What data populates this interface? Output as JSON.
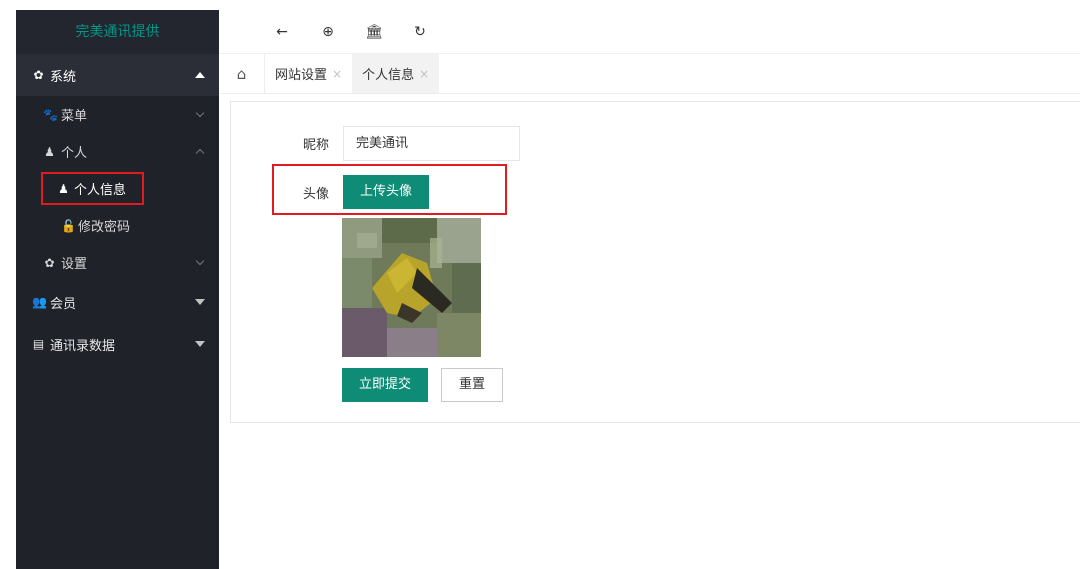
{
  "sidebar": {
    "logo": "完美通讯提供",
    "top_item": {
      "label": "系统",
      "icon": "gear-icon"
    },
    "menu": {
      "label": "菜单",
      "icon": "paw-icon"
    },
    "personal": {
      "label": "个人",
      "icon": "user-icon"
    },
    "personal_info": {
      "label": "个人信息",
      "icon": "user-icon"
    },
    "change_password": {
      "label": "修改密码",
      "icon": "lock-icon"
    },
    "settings": {
      "label": "设置",
      "icon": "gear-icon"
    },
    "members": {
      "label": "会员",
      "icon": "users-icon"
    },
    "contacts": {
      "label": "通讯录数据",
      "icon": "id-card-icon"
    }
  },
  "toolbar": {
    "back_icon": "arrow-left-icon",
    "web_icon": "globe-icon",
    "bank_icon": "bank-icon",
    "refresh_icon": "refresh-icon"
  },
  "tabs": [
    {
      "label": "网站设置",
      "close": "×"
    },
    {
      "label": "个人信息",
      "close": "×"
    }
  ],
  "form": {
    "nickname_label": "昵称",
    "nickname_value": "完美通讯",
    "avatar_label": "头像",
    "upload_button": "上传头像",
    "submit_button": "立即提交",
    "reset_button": "重置"
  },
  "colors": {
    "sidebar_bg": "#20222a",
    "accent_green": "#0f8c76",
    "logo_green": "#009688",
    "highlight_red": "#e11b22"
  }
}
